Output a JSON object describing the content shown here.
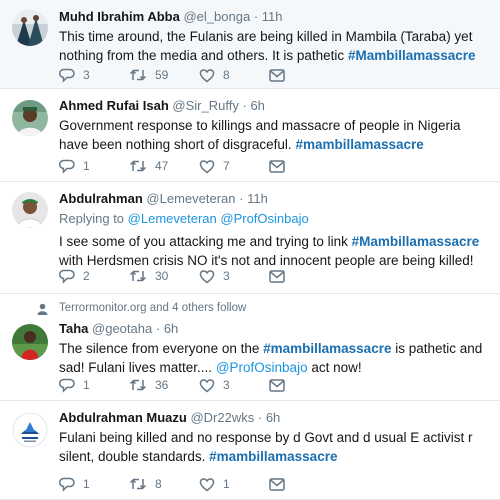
{
  "tweets": [
    {
      "name": "Muhd Ibrahim Abba",
      "handle": "@el_bonga",
      "time": "11h",
      "text": "This time around, the Fulanis are being killed in Mambila (Taraba) yet nothing from the media and others. It is pathetic",
      "hashtag": "#Mambillamassacre",
      "replies": "3",
      "retweets": "59",
      "likes": "8"
    },
    {
      "name": "Ahmed Rufai Isah",
      "handle": "@Sir_Ruffy",
      "time": "6h",
      "text": "Government response to killings and massacre of people in Nigeria have been nothing short of disgraceful.",
      "hashtag": "#mambillamassacre",
      "replies": "1",
      "retweets": "47",
      "likes": "7"
    },
    {
      "name": "Abdulrahman",
      "handle": "@Lemeveteran",
      "time": "11h",
      "reply_prefix": "Replying to",
      "reply_user1": "@Lemeveteran",
      "reply_user2": "@ProfOsinbajo",
      "text_before": "I see some of you attacking me and trying to link",
      "hashtag": "#Mambillamassacre",
      "text_after": "with Herdsmen crisis NO it's not and innocent people are being killed!",
      "replies": "2",
      "retweets": "30",
      "likes": "3"
    },
    {
      "social": "Terrormonitor.org and 4 others follow",
      "name": "Taha",
      "handle": "@geotaha",
      "time": "6h",
      "text_before": "The silence from everyone on the",
      "hashtag": "#mambillamassacre",
      "text_middle": "is pathetic and sad! Fulani lives matter....",
      "mention": "@ProfOsinbajo",
      "text_after": "act now!",
      "replies": "1",
      "retweets": "36",
      "likes": "3"
    },
    {
      "name": "Abdulrahman Muazu",
      "handle": "@Dr22wks",
      "time": "6h",
      "text": "Fulani being killed and no response by d Govt and d usual E activist r silent, double standards.",
      "hashtag": "#mambillamassacre",
      "replies": "1",
      "retweets": "8",
      "likes": "1"
    }
  ],
  "dot": "·",
  "colors": {
    "link": "#1b95e0",
    "hashtag": "#1b6fb0",
    "muted": "#657786",
    "text": "#14171a",
    "divider": "#e1e8ed"
  },
  "icons": [
    "reply-icon",
    "retweet-icon",
    "like-icon",
    "message-icon",
    "person-icon"
  ]
}
